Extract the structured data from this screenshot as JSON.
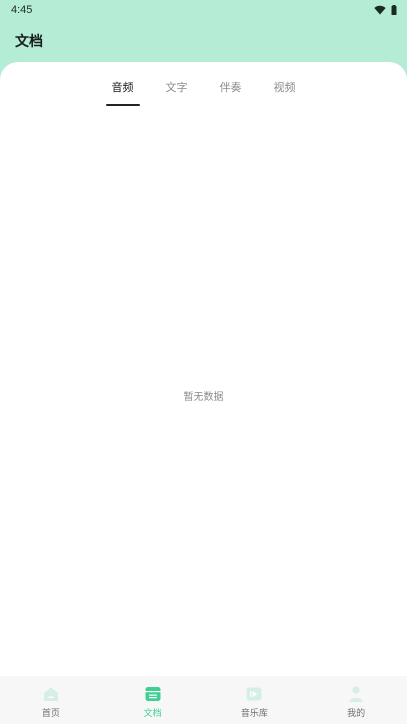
{
  "status": {
    "time": "4:45"
  },
  "header": {
    "title": "文档"
  },
  "tabs": [
    {
      "label": "音频",
      "active": true
    },
    {
      "label": "文字",
      "active": false
    },
    {
      "label": "伴奏",
      "active": false
    },
    {
      "label": "视频",
      "active": false
    }
  ],
  "empty_state": {
    "text": "暂无数据"
  },
  "bottom_nav": [
    {
      "label": "首页",
      "icon": "home-icon",
      "active": false
    },
    {
      "label": "文档",
      "icon": "document-icon",
      "active": true
    },
    {
      "label": "音乐库",
      "icon": "music-library-icon",
      "active": false
    },
    {
      "label": "我的",
      "icon": "profile-icon",
      "active": false
    }
  ],
  "colors": {
    "header_bg": "#b4ecd6",
    "accent": "#3fcf95",
    "nav_inactive_icon": "#d3ece2"
  }
}
